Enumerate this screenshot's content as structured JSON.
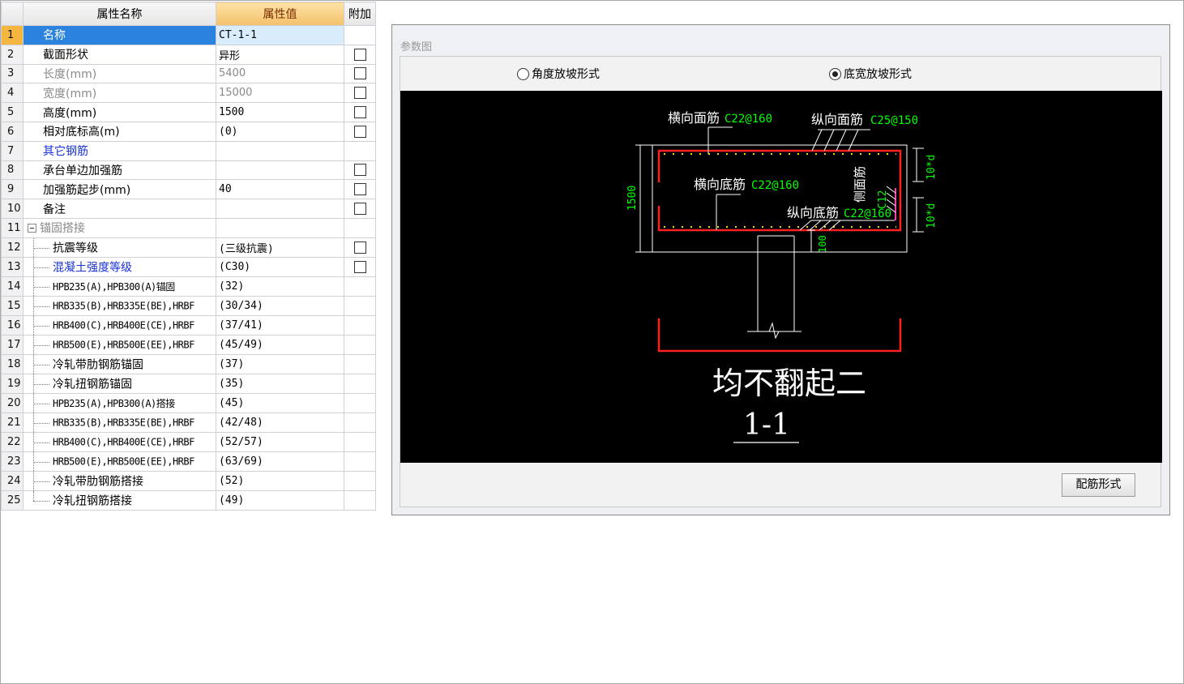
{
  "grid": {
    "headers": {
      "name": "属性名称",
      "value": "属性值",
      "extra": "附加"
    },
    "rows": [
      {
        "n": "1",
        "name": "名称",
        "value": "CT-1-1"
      },
      {
        "n": "2",
        "name": "截面形状",
        "value": "异形"
      },
      {
        "n": "3",
        "name": "长度(mm)",
        "value": "5400"
      },
      {
        "n": "4",
        "name": "宽度(mm)",
        "value": "15000"
      },
      {
        "n": "5",
        "name": "高度(mm)",
        "value": "1500"
      },
      {
        "n": "6",
        "name": "相对底标高(m)",
        "value": "(0)"
      },
      {
        "n": "7",
        "name": "其它钢筋",
        "value": ""
      },
      {
        "n": "8",
        "name": "承台单边加强筋",
        "value": ""
      },
      {
        "n": "9",
        "name": "加强筋起步(mm)",
        "value": "40"
      },
      {
        "n": "10",
        "name": "备注",
        "value": ""
      },
      {
        "n": "11",
        "name": "锚固搭接",
        "value": ""
      },
      {
        "n": "12",
        "name": "抗震等级",
        "value": "(三级抗震)"
      },
      {
        "n": "13",
        "name": "混凝土强度等级",
        "value": "(C30)"
      },
      {
        "n": "14",
        "name": "HPB235(A),HPB300(A)锚固",
        "value": "(32)"
      },
      {
        "n": "15",
        "name": "HRB335(B),HRB335E(BE),HRBF",
        "value": "(30/34)"
      },
      {
        "n": "16",
        "name": "HRB400(C),HRB400E(CE),HRBF",
        "value": "(37/41)"
      },
      {
        "n": "17",
        "name": "HRB500(E),HRB500E(EE),HRBF",
        "value": "(45/49)"
      },
      {
        "n": "18",
        "name": "冷轧带肋钢筋锚固",
        "value": "(37)"
      },
      {
        "n": "19",
        "name": "冷轧扭钢筋锚固",
        "value": "(35)"
      },
      {
        "n": "20",
        "name": "HPB235(A),HPB300(A)搭接",
        "value": "(45)"
      },
      {
        "n": "21",
        "name": "HRB335(B),HRB335E(BE),HRBF",
        "value": "(42/48)"
      },
      {
        "n": "22",
        "name": "HRB400(C),HRB400E(CE),HRBF",
        "value": "(52/57)"
      },
      {
        "n": "23",
        "name": "HRB500(E),HRB500E(EE),HRBF",
        "value": "(63/69)"
      },
      {
        "n": "24",
        "name": "冷轧带肋钢筋搭接",
        "value": "(52)"
      },
      {
        "n": "25",
        "name": "冷轧扭钢筋搭接",
        "value": "(49)"
      }
    ]
  },
  "panel": {
    "title": "参数图",
    "radio_angle": "角度放坡形式",
    "radio_width": "底宽放坡形式",
    "button": "配筋形式"
  },
  "drawing": {
    "top_transverse": "横向面筋",
    "top_transverse_spec": "C22@160",
    "top_longitudinal": "纵向面筋",
    "top_longitudinal_spec": "C25@150",
    "bottom_transverse": "横向底筋",
    "bottom_transverse_spec": "C22@160",
    "bottom_longitudinal": "纵向底筋",
    "bottom_longitudinal_spec": "C22@160",
    "side": "侧面筋",
    "side_spec": "C12",
    "height": "1500",
    "cover": "100",
    "anchor_top": "10*d",
    "anchor_bottom": "10*d",
    "caption": "均不翻起二",
    "section": "1-1"
  },
  "colors": {
    "rebar": "#ff2020",
    "spec": "#00ff00",
    "line": "#ffffff"
  }
}
